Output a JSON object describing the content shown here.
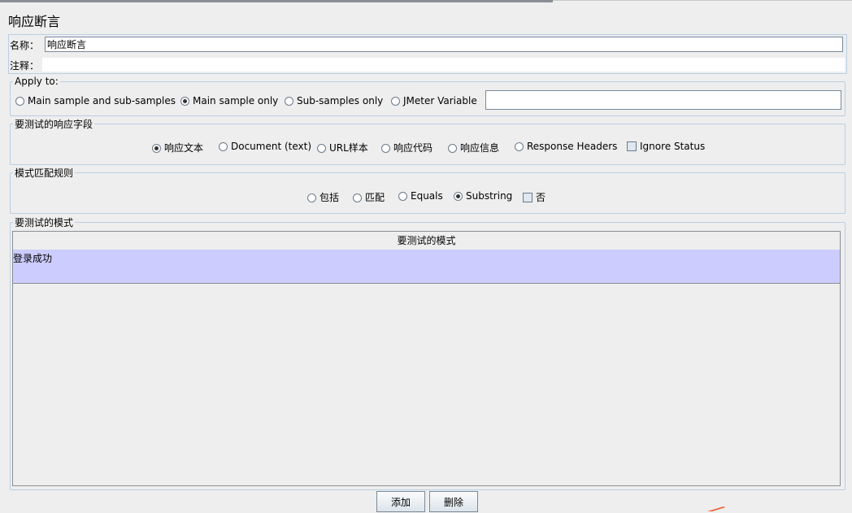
{
  "title": "响应断言",
  "name_label": "名称：",
  "name_value": "响应断言",
  "comment_label": "注释：",
  "apply_to": {
    "legend": "Apply to:",
    "options": [
      "Main sample and sub-samples",
      "Main sample only",
      "Sub-samples only",
      "JMeter Variable"
    ],
    "selected": "Main sample only",
    "variable_value": ""
  },
  "response_field": {
    "legend": "要测试的响应字段",
    "options": [
      "响应文本",
      "Document (text)",
      "URL样本",
      "响应代码",
      "响应信息",
      "Response Headers"
    ],
    "selected": "响应文本",
    "ignore_status_label": "Ignore Status",
    "ignore_status_checked": false
  },
  "pattern_rule": {
    "legend": "模式匹配规则",
    "options": [
      "包括",
      "匹配",
      "Equals",
      "Substring"
    ],
    "selected": "Substring",
    "not_label": "否",
    "not_checked": false
  },
  "patterns": {
    "legend": "要测试的模式",
    "column_header": "要测试的模式",
    "rows": [
      "登录成功"
    ]
  },
  "buttons": {
    "add": "添加",
    "delete": "删除"
  },
  "colors": {
    "selected_row": "#ccccff",
    "border": "#b8cfe5",
    "background": "#eeeeee"
  }
}
